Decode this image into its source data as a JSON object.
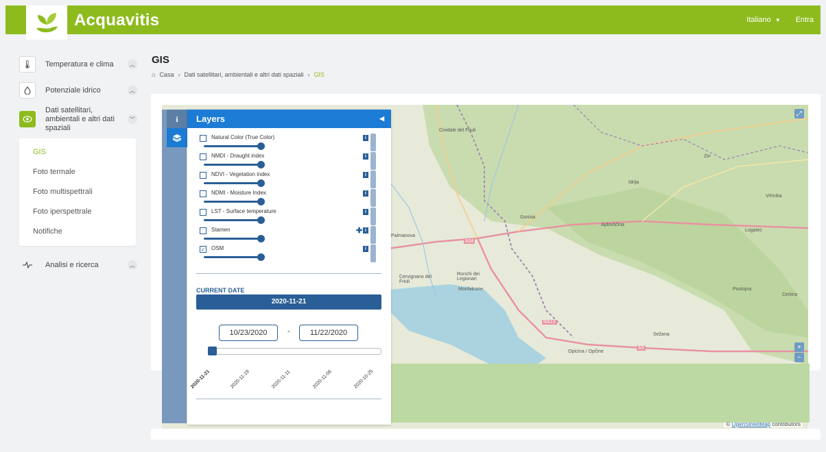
{
  "header": {
    "brand": "Acquavitis",
    "language": "Italiano",
    "login": "Entra"
  },
  "sidebar": {
    "items": [
      {
        "label": "Temperatura e clima",
        "icon": "thermometer-icon"
      },
      {
        "label": "Potenziale idrico",
        "icon": "droplet-icon"
      },
      {
        "label": "Dati satellitari, ambientali e altri dati spaziali",
        "icon": "eye-icon"
      },
      {
        "label": "Analisi e ricerca",
        "icon": "pulse-icon"
      }
    ],
    "submenu": [
      "GIS",
      "Foto termale",
      "Foto multispettrali",
      "Foto iperspettrale",
      "Notifiche"
    ]
  },
  "page": {
    "title": "GIS",
    "breadcrumb": [
      "Casa",
      "Dati satellitari, ambientali e altri dati spaziali",
      "GIS"
    ]
  },
  "layers_panel": {
    "title": "Layers",
    "layers": [
      {
        "name": "Natural Color (True Color)",
        "checked": false
      },
      {
        "name": "NMDI - Draught index",
        "checked": false
      },
      {
        "name": "NDVI - Vegetation index",
        "checked": false
      },
      {
        "name": "NDMI - Moisture Index",
        "checked": false
      },
      {
        "name": "LST - Surface temperature",
        "checked": false
      },
      {
        "name": "Stamen",
        "checked": false
      },
      {
        "name": "OSM",
        "checked": true
      }
    ],
    "current_date_label": "CURRENT DATE",
    "current_date": "2020-11-21",
    "date_from": "10/23/2020",
    "date_to": "11/22/2020",
    "timeline_ticks": [
      "2020-11-21",
      "2020-11-19",
      "2020-11-11",
      "2020-11-06",
      "2020-10-25"
    ]
  },
  "map": {
    "labels": [
      "Cividale del Friuli",
      "Gorizia",
      "Idrija",
      "Ziri",
      "Vrhnika",
      "Logatec",
      "Ajdovščina",
      "Palmanova",
      "Cervignano del Friuli",
      "Ronchi dei Legionari",
      "Monfalcone",
      "Postojna",
      "Cerkno",
      "Sežana",
      "Opicina / Opčine",
      "A34",
      "RA13",
      "A3"
    ],
    "attribution_link": "OpenStreetMap",
    "attribution_text": " contributors"
  },
  "colors": {
    "brand_green": "#8dbb1e",
    "panel_blue": "#1c7bd4",
    "dark_blue": "#2a5e96"
  }
}
